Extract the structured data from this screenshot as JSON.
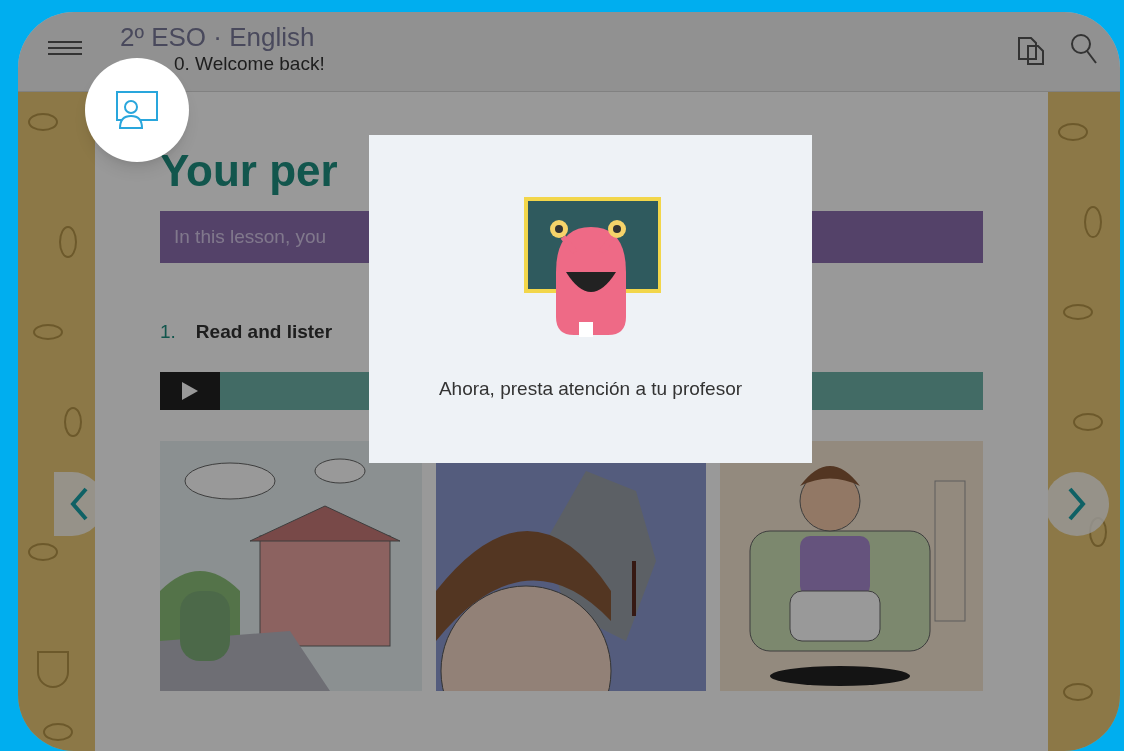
{
  "header": {
    "course": "2º ESO · English",
    "unit": "0. Welcome back!"
  },
  "lesson": {
    "title": "Your per",
    "intro": "In this lesson, you",
    "exercise": {
      "number": "1.",
      "instruction": "Read and lister"
    }
  },
  "modal": {
    "message": "Ahora, presta atención a tu profesor"
  }
}
